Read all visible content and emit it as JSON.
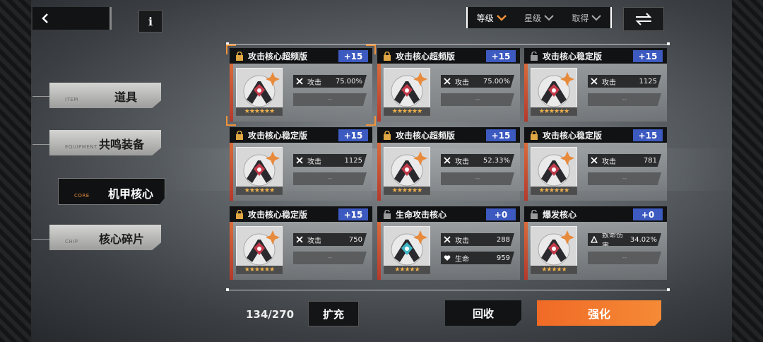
{
  "sort": {
    "items": [
      {
        "label": "等级",
        "active": true
      },
      {
        "label": "星级",
        "active": false
      },
      {
        "label": "取得",
        "active": false
      }
    ]
  },
  "info_label": "i",
  "menu": [
    {
      "en": "ITEM",
      "zh": "道具",
      "active": false
    },
    {
      "en": "EQUIPMENT",
      "zh": "共鸣装备",
      "active": false
    },
    {
      "en": "CORE",
      "zh": "机甲核心",
      "active": true
    },
    {
      "en": "CHIP",
      "zh": "核心碎片",
      "active": false
    }
  ],
  "cards": [
    {
      "title": "攻击核心超频版",
      "plus": "+15",
      "locked": true,
      "stars": "★★★★★★",
      "stats": [
        {
          "icon": "sword-icon",
          "label": "攻击",
          "value": "75.00%"
        },
        {
          "icon": "",
          "label": "",
          "value": "--"
        }
      ]
    },
    {
      "title": "攻击核心超频版",
      "plus": "+15",
      "locked": true,
      "stars": "★★★★★★",
      "stats": [
        {
          "icon": "sword-icon",
          "label": "攻击",
          "value": "75.00%"
        },
        {
          "icon": "",
          "label": "",
          "value": "--"
        }
      ]
    },
    {
      "title": "攻击核心稳定版",
      "plus": "+15",
      "locked": false,
      "stars": "★★★★★★",
      "stats": [
        {
          "icon": "sword-icon",
          "label": "攻击",
          "value": "1125"
        },
        {
          "icon": "",
          "label": "",
          "value": "--"
        }
      ]
    },
    {
      "title": "攻击核心稳定版",
      "plus": "+15",
      "locked": true,
      "stars": "★★★★★★",
      "stats": [
        {
          "icon": "sword-icon",
          "label": "攻击",
          "value": "1125"
        },
        {
          "icon": "",
          "label": "",
          "value": "--"
        }
      ]
    },
    {
      "title": "攻击核心超频版",
      "plus": "+15",
      "locked": true,
      "stars": "★★★★★★",
      "stats": [
        {
          "icon": "sword-icon",
          "label": "攻击",
          "value": "52.33%"
        },
        {
          "icon": "",
          "label": "",
          "value": "--"
        }
      ]
    },
    {
      "title": "攻击核心稳定版",
      "plus": "+15",
      "locked": true,
      "stars": "★★★★★★",
      "stats": [
        {
          "icon": "sword-icon",
          "label": "攻击",
          "value": "781"
        },
        {
          "icon": "",
          "label": "",
          "value": "--"
        }
      ]
    },
    {
      "title": "攻击核心稳定版",
      "plus": "+15",
      "locked": true,
      "stars": "★★★★★★",
      "stats": [
        {
          "icon": "sword-icon",
          "label": "攻击",
          "value": "750"
        },
        {
          "icon": "",
          "label": "",
          "value": "--"
        }
      ]
    },
    {
      "title": "生命攻击核心",
      "plus": "+0",
      "locked": false,
      "stars": "★★★★★",
      "stats": [
        {
          "icon": "sword-icon",
          "label": "攻击",
          "value": "288"
        },
        {
          "icon": "heart-icon",
          "label": "生命",
          "value": "959"
        }
      ]
    },
    {
      "title": "爆发核心",
      "plus": "+0",
      "locked": false,
      "stars": "★★★★★",
      "stats": [
        {
          "icon": "triangle-icon",
          "label": "致命伤害",
          "value": "34.02%"
        },
        {
          "icon": "",
          "label": "",
          "value": "--"
        }
      ]
    }
  ],
  "inventory_count": "134/270",
  "expand_label": "扩充",
  "recycle_label": "回收",
  "enhance_label": "强化",
  "colors": {
    "accent": "#f0923a",
    "plus_badge": "#3d5ac1",
    "enhance": "#f06a26"
  }
}
